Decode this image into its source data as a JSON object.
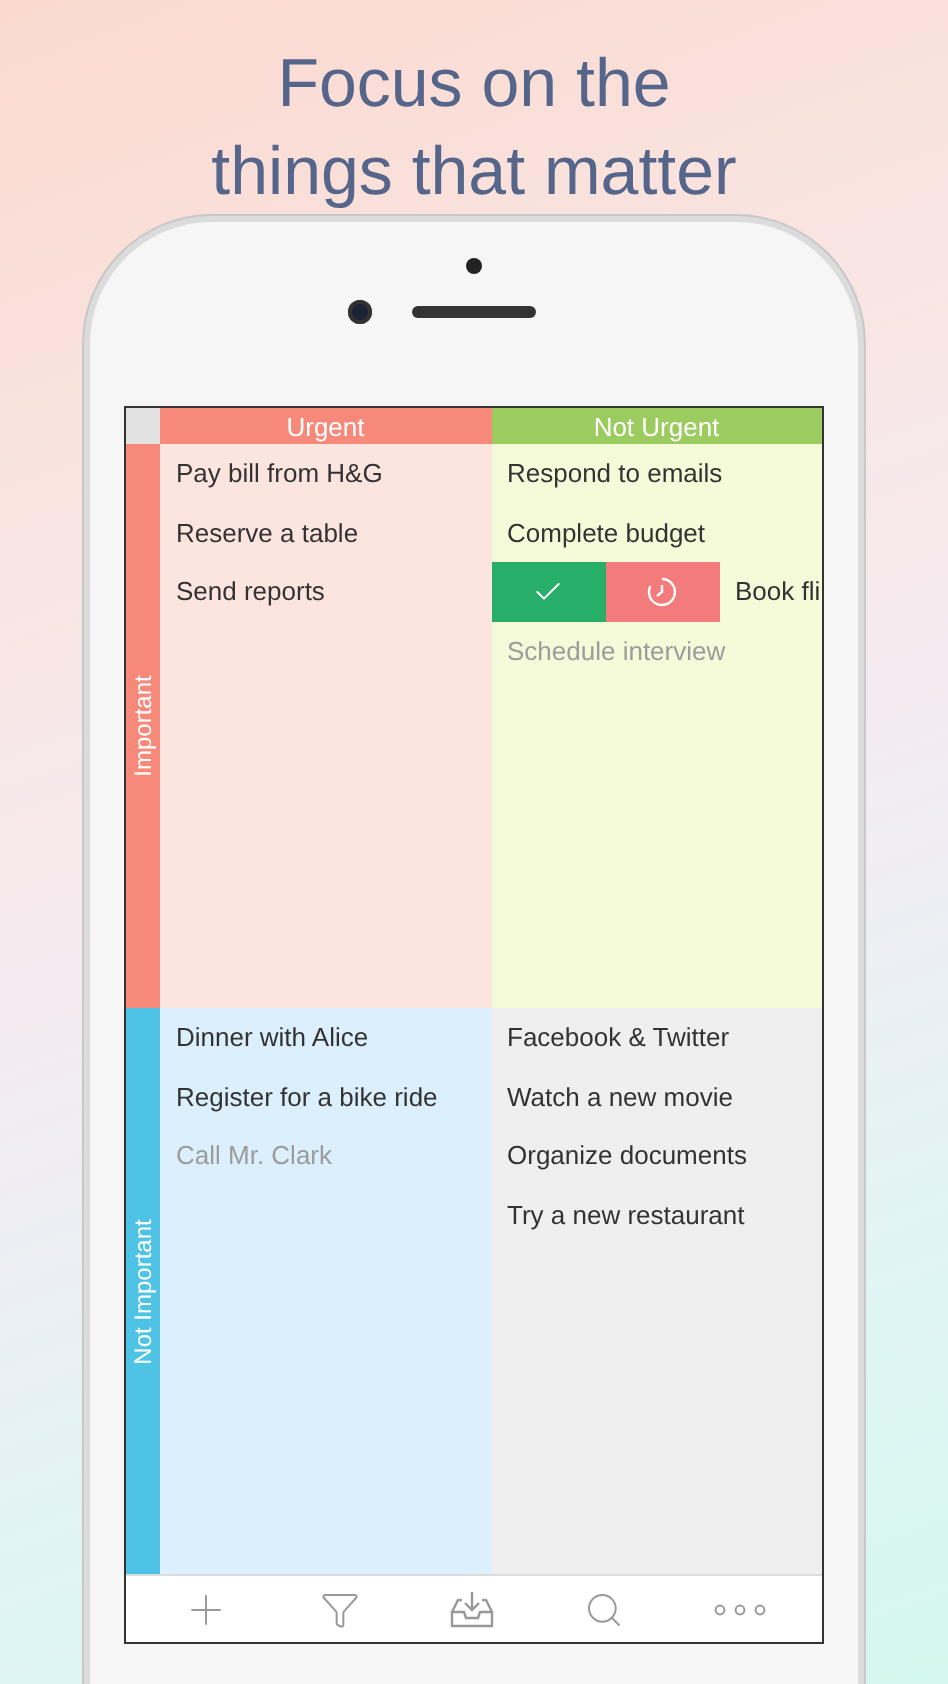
{
  "headline": [
    "Focus on the",
    "things that matter"
  ],
  "columns": [
    {
      "label": "Urgent",
      "color": "#f7897b"
    },
    {
      "label": "Not Urgent",
      "color": "#9ccb5f"
    }
  ],
  "rows": [
    {
      "label": "Important",
      "color": "#f7897b",
      "quadrants": [
        {
          "color": "#fde5df",
          "tasks": [
            {
              "kind": "task",
              "text": "Pay bill from H&G",
              "done": false
            },
            {
              "kind": "task",
              "text": "Reserve a table",
              "done": false
            },
            {
              "kind": "task",
              "text": "Send reports",
              "done": false
            }
          ]
        },
        {
          "color": "#f5fad9",
          "tasks": [
            {
              "kind": "task",
              "text": "Respond to emails",
              "done": false
            },
            {
              "kind": "task",
              "text": "Complete budget",
              "done": false
            },
            {
              "kind": "swiped",
              "text": "Book fli",
              "done": false
            },
            {
              "kind": "task",
              "text": "Schedule interview",
              "done": true
            }
          ]
        }
      ]
    },
    {
      "label": "Not Important",
      "color": "#4fc3e6",
      "quadrants": [
        {
          "color": "#dbeffc",
          "tasks": [
            {
              "kind": "task",
              "text": "Dinner with Alice",
              "done": false
            },
            {
              "kind": "task",
              "text": "Register for a bike ride",
              "done": false
            },
            {
              "kind": "task",
              "text": "Call Mr. Clark",
              "done": true
            }
          ]
        },
        {
          "color": "#efefef",
          "tasks": [
            {
              "kind": "task",
              "text": "Facebook & Twitter",
              "done": false
            },
            {
              "kind": "task",
              "text": "Watch a new movie",
              "done": false
            },
            {
              "kind": "task",
              "text": "Organize documents",
              "done": false
            },
            {
              "kind": "task",
              "text": "Try a new restaurant",
              "done": false
            }
          ]
        }
      ]
    }
  ],
  "toolbar": [
    {
      "kind": "add"
    },
    {
      "kind": "filter"
    },
    {
      "kind": "inbox"
    },
    {
      "kind": "search"
    },
    {
      "kind": "more"
    }
  ]
}
